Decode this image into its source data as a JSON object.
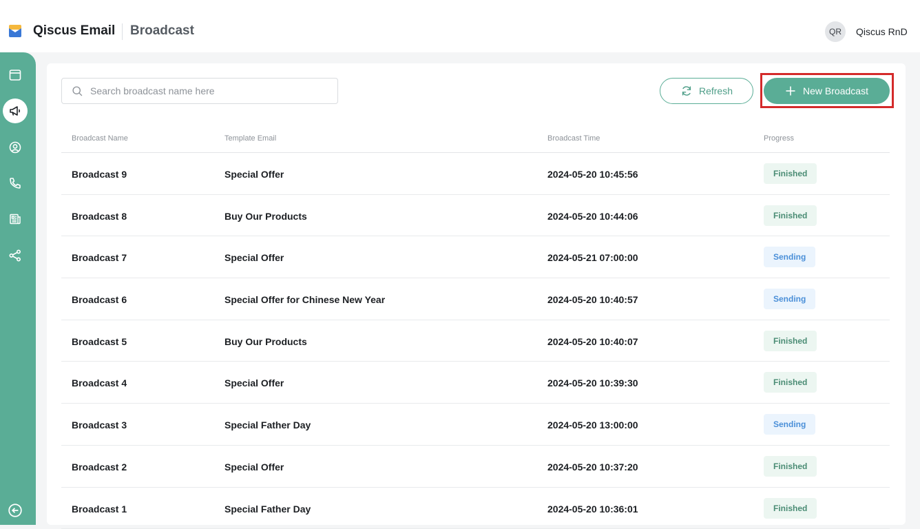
{
  "header": {
    "app_name": "Qiscus Email",
    "page_title": "Broadcast",
    "user_initials": "QR",
    "user_name": "Qiscus RnD"
  },
  "sidebar": {
    "items": [
      {
        "name": "inbox",
        "icon": "browser-window-icon",
        "active": false
      },
      {
        "name": "broadcast",
        "icon": "megaphone-icon",
        "active": true
      },
      {
        "name": "contacts",
        "icon": "user-circle-icon",
        "active": false
      },
      {
        "name": "calls",
        "icon": "phone-icon",
        "active": false
      },
      {
        "name": "templates",
        "icon": "newspaper-icon",
        "active": false
      },
      {
        "name": "integrations",
        "icon": "share-nodes-icon",
        "active": false
      }
    ],
    "collapse_icon": "arrow-left-circle-icon"
  },
  "toolbar": {
    "search_placeholder": "Search broadcast name here",
    "refresh_label": "Refresh",
    "new_broadcast_label": "New Broadcast"
  },
  "table": {
    "headers": [
      "Broadcast Name",
      "Template Email",
      "Broadcast Time",
      "Progress"
    ],
    "rows": [
      {
        "name": "Broadcast 9",
        "template": "Special Offer",
        "time": "2024-05-20 10:45:56",
        "progress": "Finished"
      },
      {
        "name": "Broadcast 8",
        "template": "Buy Our Products",
        "time": "2024-05-20 10:44:06",
        "progress": "Finished"
      },
      {
        "name": "Broadcast 7",
        "template": "Special Offer",
        "time": "2024-05-21 07:00:00",
        "progress": "Sending"
      },
      {
        "name": "Broadcast 6",
        "template": "Special Offer for Chinese New Year",
        "time": "2024-05-20 10:40:57",
        "progress": "Sending"
      },
      {
        "name": "Broadcast 5",
        "template": "Buy Our Products",
        "time": "2024-05-20 10:40:07",
        "progress": "Finished"
      },
      {
        "name": "Broadcast 4",
        "template": "Special Offer",
        "time": "2024-05-20 10:39:30",
        "progress": "Finished"
      },
      {
        "name": "Broadcast 3",
        "template": "Special Father Day",
        "time": "2024-05-20 13:00:00",
        "progress": "Sending"
      },
      {
        "name": "Broadcast 2",
        "template": "Special Offer",
        "time": "2024-05-20 10:37:20",
        "progress": "Finished"
      },
      {
        "name": "Broadcast 1",
        "template": "Special Father Day",
        "time": "2024-05-20 10:36:01",
        "progress": "Finished"
      }
    ]
  },
  "colors": {
    "accent": "#5aad96",
    "finished_bg": "#ecf6f1",
    "finished_text": "#4a8c74",
    "sending_bg": "#ebf4fd",
    "sending_text": "#4a8fd8",
    "highlight": "#d42a2a"
  }
}
